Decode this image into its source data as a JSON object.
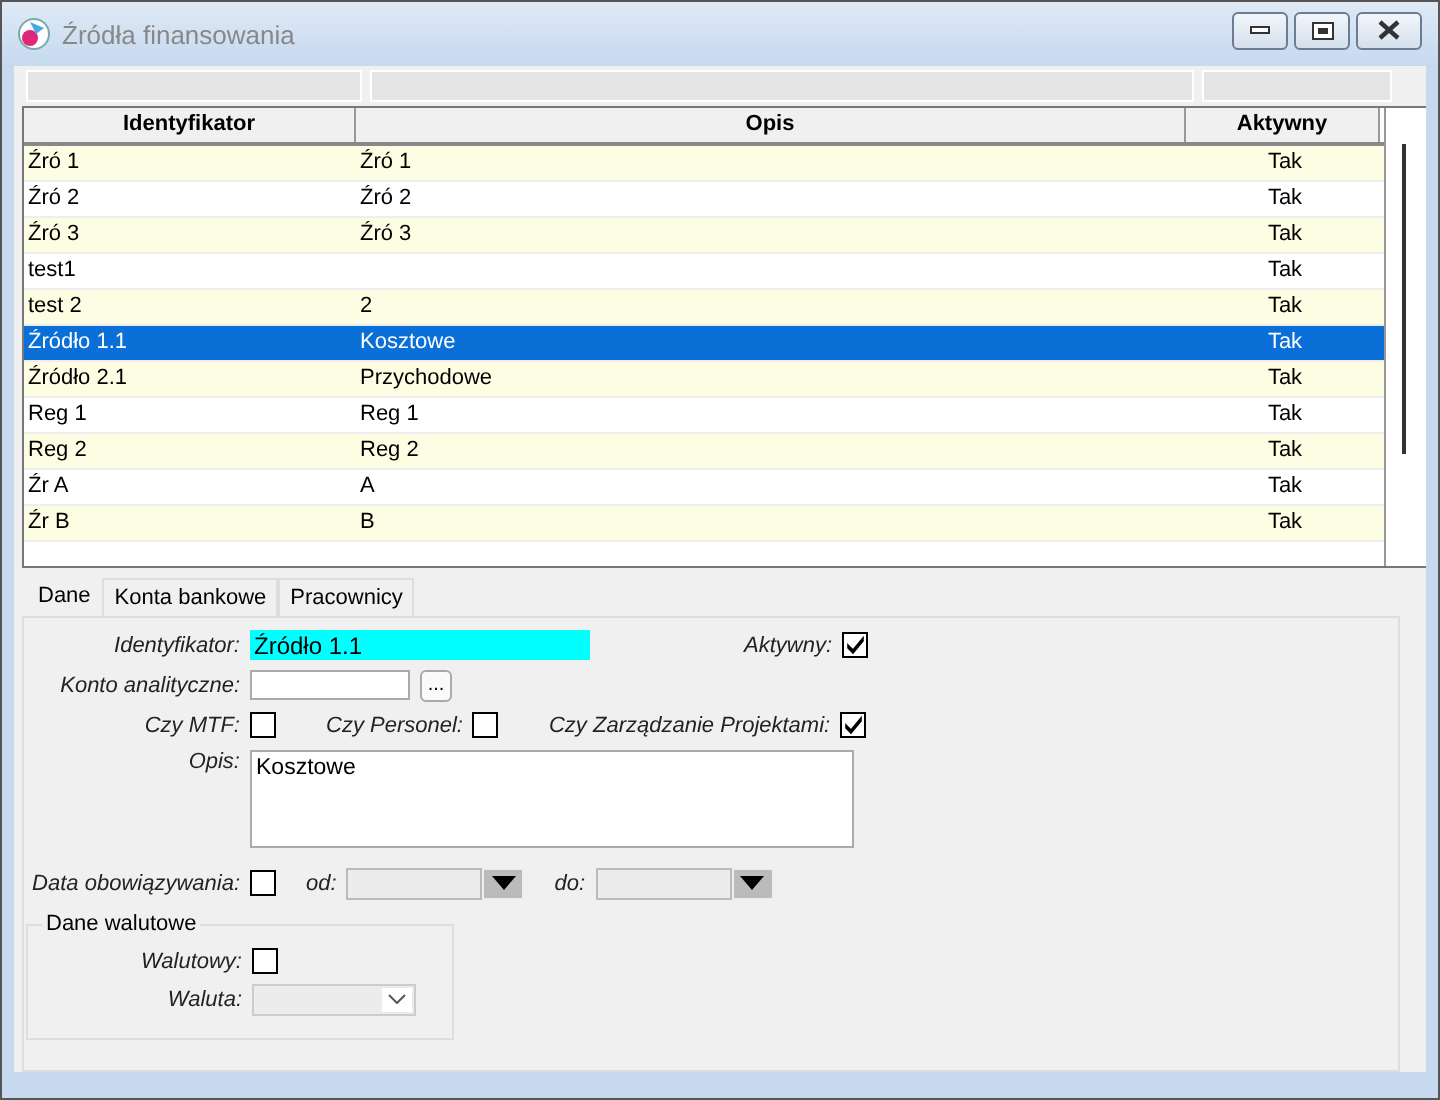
{
  "window": {
    "title": "Źródła finansowania"
  },
  "table": {
    "columns": [
      "Identyfikator",
      "Opis",
      "Aktywny"
    ],
    "rows": [
      {
        "id": "Źró 1",
        "opis": "Źró 1",
        "aktywny": "Tak",
        "selected": false
      },
      {
        "id": "Źró 2",
        "opis": "Źró 2",
        "aktywny": "Tak",
        "selected": false
      },
      {
        "id": "Źró 3",
        "opis": "Źró 3",
        "aktywny": "Tak",
        "selected": false
      },
      {
        "id": "test1",
        "opis": "",
        "aktywny": "Tak",
        "selected": false
      },
      {
        "id": "test 2",
        "opis": "2",
        "aktywny": "Tak",
        "selected": false
      },
      {
        "id": "Źródło 1.1",
        "opis": "Kosztowe",
        "aktywny": "Tak",
        "selected": true
      },
      {
        "id": "Źródło 2.1",
        "opis": "Przychodowe",
        "aktywny": "Tak",
        "selected": false
      },
      {
        "id": "Reg 1",
        "opis": "Reg 1",
        "aktywny": "Tak",
        "selected": false
      },
      {
        "id": "Reg 2",
        "opis": "Reg 2",
        "aktywny": "Tak",
        "selected": false
      },
      {
        "id": "Źr A",
        "opis": "A",
        "aktywny": "Tak",
        "selected": false
      },
      {
        "id": "Źr B",
        "opis": "B",
        "aktywny": "Tak",
        "selected": false
      }
    ]
  },
  "tabs": [
    {
      "label": "Dane",
      "selected": true
    },
    {
      "label": "Konta bankowe",
      "selected": false
    },
    {
      "label": "Pracownicy",
      "selected": false
    }
  ],
  "form": {
    "identyfikator": {
      "label": "Identyfikator:",
      "value": "Źródło 1.1"
    },
    "aktywny": {
      "label": "Aktywny:",
      "checked": true
    },
    "konto": {
      "label": "Konto analityczne:",
      "button": "..."
    },
    "mtf": {
      "label": "Czy MTF:",
      "checked": false
    },
    "personel": {
      "label": "Czy Personel:",
      "checked": false
    },
    "projekty": {
      "label": "Czy Zarządzanie Projektami:",
      "checked": true
    },
    "opis": {
      "label": "Opis:",
      "value": "Kosztowe"
    },
    "data": {
      "label": "Data obowiązywania:",
      "checked": false,
      "od": "od:",
      "do": "do:"
    },
    "waluty": {
      "title": "Dane walutowe",
      "walutowy": {
        "label": "Walutowy:",
        "checked": false
      },
      "waluta": {
        "label": "Waluta:"
      }
    }
  }
}
